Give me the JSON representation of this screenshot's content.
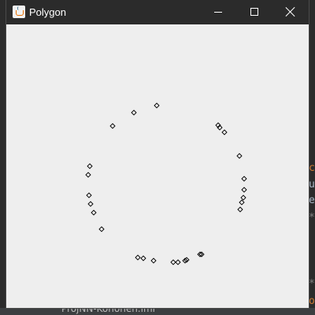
{
  "window": {
    "title": "Polygon"
  },
  "icons": {
    "app": "java-cup-icon",
    "minimize": "minimize-icon",
    "maximize": "maximize-icon",
    "close": "close-icon"
  },
  "background_ide": {
    "file_name": "ProjNN-Kohonen.iml",
    "side_glyphs": [
      "c",
      "u",
      "e",
      "*",
      "*",
      "o"
    ]
  },
  "colors": {
    "titlebar": "#2b2b2b",
    "canvas": "#eeeeee",
    "point_stroke": "#000000"
  },
  "points_count": 31
}
